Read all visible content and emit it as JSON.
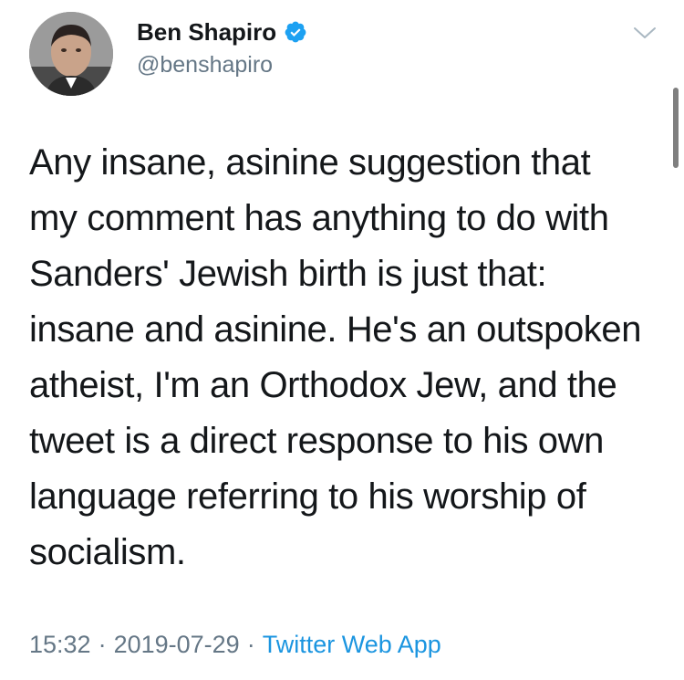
{
  "author": {
    "display_name": "Ben Shapiro",
    "handle": "@benshapiro",
    "verified": true
  },
  "tweet": {
    "text": "Any insane, asinine suggestion that\nmy comment has anything to do with\nSanders' Jewish birth is just that:\ninsane and asinine. He's an outspoken\natheist, I'm an Orthodox Jew, and the\ntweet is a direct response to his own\nlanguage referring to his worship of\nsocialism.",
    "time": "15:32",
    "date": "2019-07-29",
    "separator": "·",
    "source": "Twitter Web App"
  },
  "icons": {
    "verified": "verified-badge-icon",
    "menu": "chevron-down-icon"
  },
  "colors": {
    "text": "#14171a",
    "secondary": "#657786",
    "link": "#1b95e0",
    "verified": "#1da1f2"
  }
}
